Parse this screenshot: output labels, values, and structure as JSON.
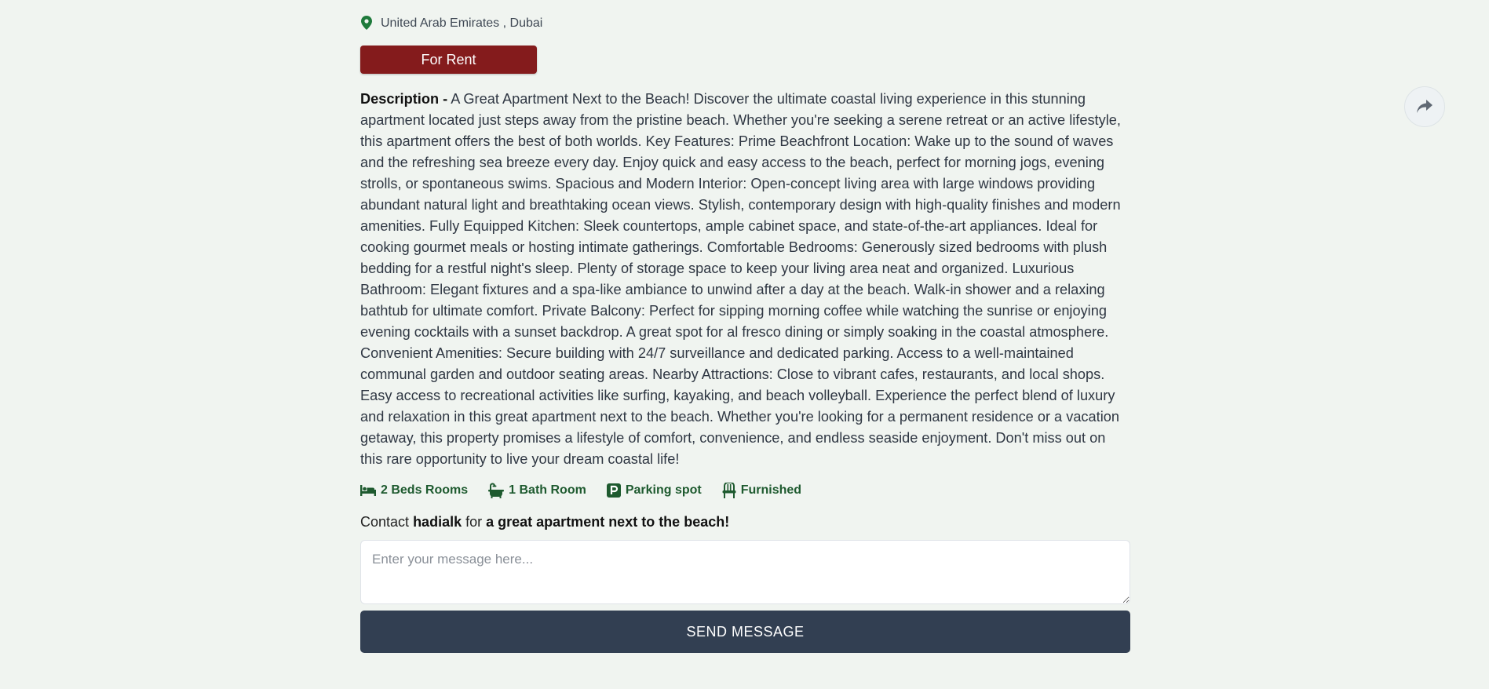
{
  "location": {
    "icon": "map-pin-icon",
    "text": "United Arab Emirates , Dubai",
    "icon_color": "#1e7a3b"
  },
  "badge": {
    "label": "For Rent",
    "color": "#841b1c"
  },
  "description": {
    "label": "Description -",
    "text": "A Great Apartment Next to the Beach! Discover the ultimate coastal living experience in this stunning apartment located just steps away from the pristine beach. Whether you're seeking a serene retreat or an active lifestyle, this apartment offers the best of both worlds. Key Features: Prime Beachfront Location: Wake up to the sound of waves and the refreshing sea breeze every day. Enjoy quick and easy access to the beach, perfect for morning jogs, evening strolls, or spontaneous swims. Spacious and Modern Interior: Open-concept living area with large windows providing abundant natural light and breathtaking ocean views. Stylish, contemporary design with high-quality finishes and modern amenities. Fully Equipped Kitchen: Sleek countertops, ample cabinet space, and state-of-the-art appliances. Ideal for cooking gourmet meals or hosting intimate gatherings. Comfortable Bedrooms: Generously sized bedrooms with plush bedding for a restful night's sleep. Plenty of storage space to keep your living area neat and organized. Luxurious Bathroom: Elegant fixtures and a spa-like ambiance to unwind after a day at the beach. Walk-in shower and a relaxing bathtub for ultimate comfort. Private Balcony: Perfect for sipping morning coffee while watching the sunrise or enjoying evening cocktails with a sunset backdrop. A great spot for al fresco dining or simply soaking in the coastal atmosphere. Convenient Amenities: Secure building with 24/7 surveillance and dedicated parking. Access to a well-maintained communal garden and outdoor seating areas. Nearby Attractions: Close to vibrant cafes, restaurants, and local shops. Easy access to recreational activities like surfing, kayaking, and beach volleyball. Experience the perfect blend of luxury and relaxation in this great apartment next to the beach. Whether you're looking for a permanent residence or a vacation getaway, this property promises a lifestyle of comfort, convenience, and endless seaside enjoyment. Don't miss out on this rare opportunity to live your dream coastal life!"
  },
  "features": [
    {
      "icon": "bed-icon",
      "label": "2 Beds Rooms"
    },
    {
      "icon": "bathtub-icon",
      "label": "1 Bath Room"
    },
    {
      "icon": "parking-icon",
      "label": "Parking spot"
    },
    {
      "icon": "chair-icon",
      "label": "Furnished"
    }
  ],
  "contact": {
    "prefix": "Contact",
    "user": "hadialk",
    "middle": "for",
    "title": "a great apartment next to the beach!"
  },
  "message": {
    "placeholder": "Enter your message here...",
    "value": ""
  },
  "send_button": {
    "label": "SEND MESSAGE",
    "color": "#323f52"
  },
  "share": {
    "icon": "share-icon"
  },
  "colors": {
    "background": "#f0f4f0",
    "feature_text": "#1e5a2f"
  }
}
